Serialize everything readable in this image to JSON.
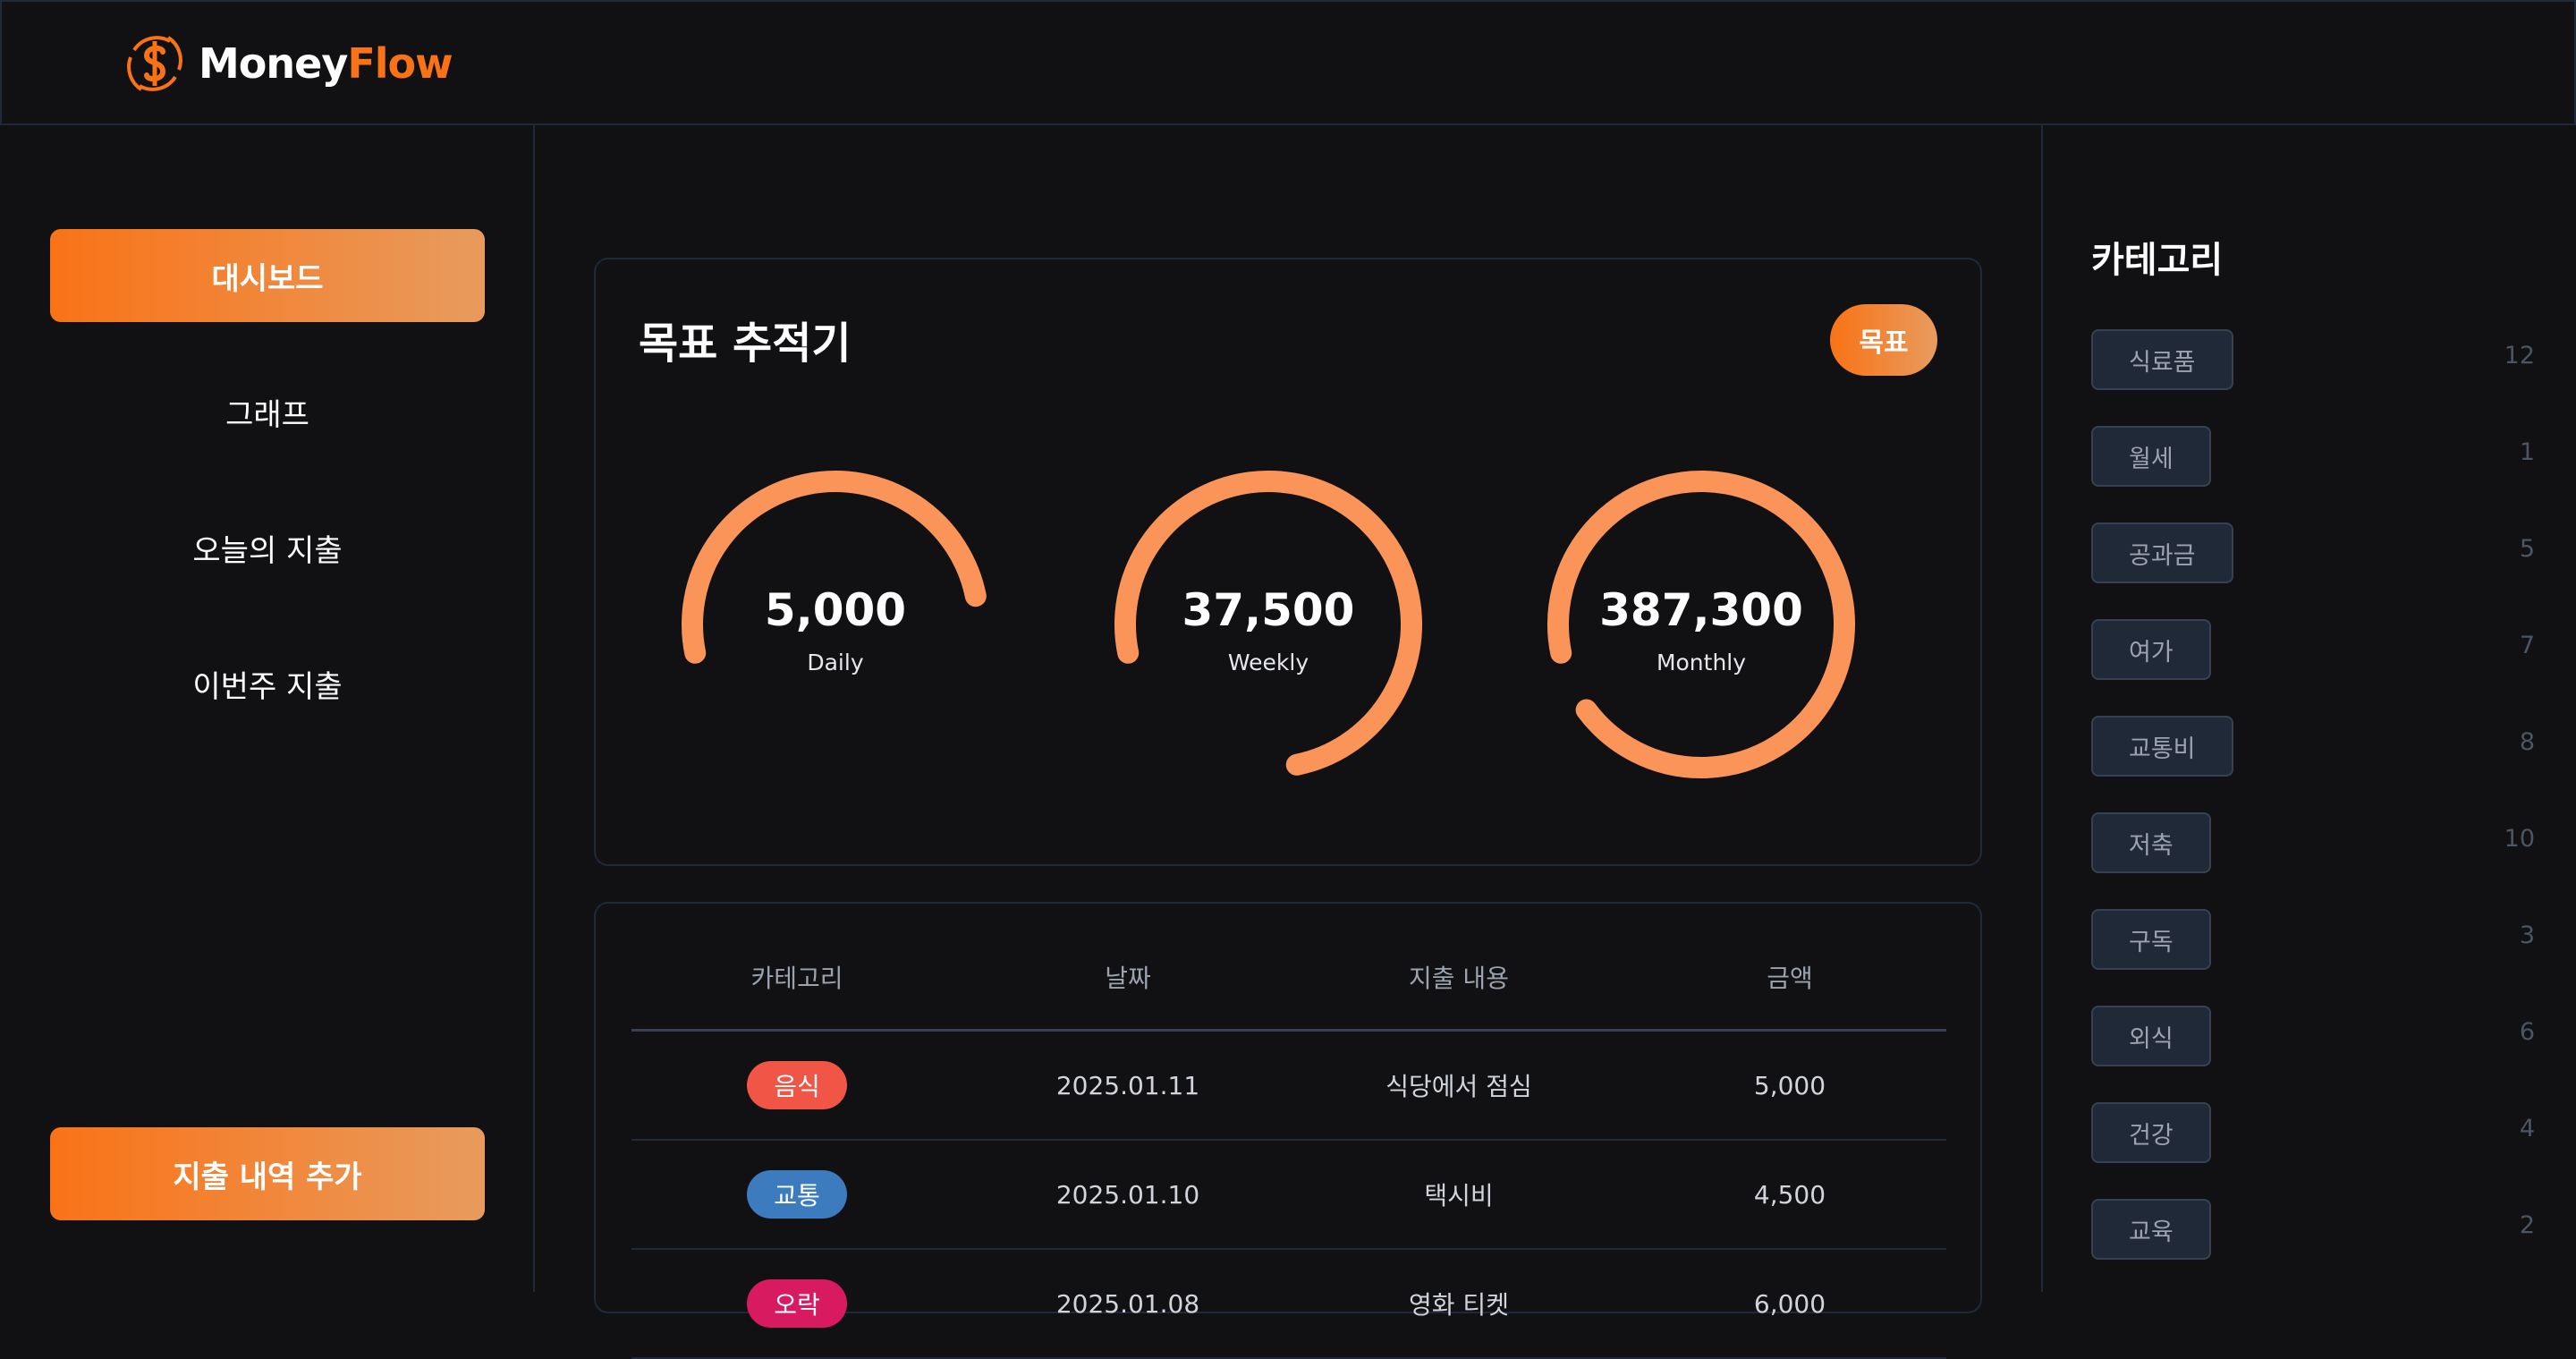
{
  "app": {
    "name_part1": "Money",
    "name_part2": "Flow"
  },
  "colors": {
    "accent": "#f97316",
    "accent_light": "#e89b5e",
    "background": "#111113",
    "border": "#1f2937"
  },
  "sidebar": {
    "items": [
      {
        "label": "대시보드",
        "active": true
      },
      {
        "label": "그래프",
        "active": false
      },
      {
        "label": "오늘의 지출",
        "active": false
      },
      {
        "label": "이번주 지출",
        "active": false
      }
    ],
    "add_button": "지출 내역 추가"
  },
  "goal_tracker": {
    "title": "목표 추적기",
    "badge": "목표",
    "gauges": [
      {
        "value": "5,000",
        "label": "Daily",
        "progress": 0.5
      },
      {
        "value": "37,500",
        "label": "Weekly",
        "progress": 0.75
      },
      {
        "value": "387,300",
        "label": "Monthly",
        "progress": 0.93
      }
    ]
  },
  "table": {
    "headers": [
      "카테고리",
      "날짜",
      "지출 내용",
      "금액"
    ],
    "rows": [
      {
        "category": "음식",
        "category_color": "#f05545",
        "date": "2025.01.11",
        "description": "식당에서 점심",
        "amount": "5,000"
      },
      {
        "category": "교통",
        "category_color": "#3d7bbf",
        "date": "2025.01.10",
        "description": "택시비",
        "amount": "4,500"
      },
      {
        "category": "오락",
        "category_color": "#d81b60",
        "date": "2025.01.08",
        "description": "영화 티켓",
        "amount": "6,000"
      }
    ]
  },
  "categories": {
    "title": "카테고리",
    "items": [
      {
        "name": "식료품",
        "count": "12"
      },
      {
        "name": "월세",
        "count": "1"
      },
      {
        "name": "공과금",
        "count": "5"
      },
      {
        "name": "여가",
        "count": "7"
      },
      {
        "name": "교통비",
        "count": "8"
      },
      {
        "name": "저축",
        "count": "10"
      },
      {
        "name": "구독",
        "count": "3"
      },
      {
        "name": "외식",
        "count": "6"
      },
      {
        "name": "건강",
        "count": "4"
      },
      {
        "name": "교육",
        "count": "2"
      }
    ]
  }
}
